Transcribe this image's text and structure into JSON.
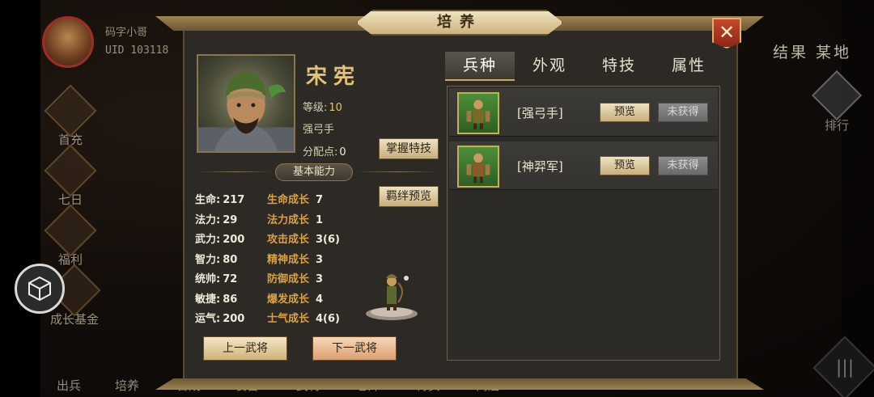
{
  "scene": {
    "player": {
      "name": "码字小哥",
      "uid": "UID  103118"
    },
    "right_title": "结果 某地",
    "rank_label": "排行",
    "side_buttons": [
      {
        "label": "首充"
      },
      {
        "label": "七日"
      },
      {
        "label": "福利"
      },
      {
        "label": "成长基金"
      }
    ],
    "bottom_buttons": [
      {
        "label": "出兵"
      },
      {
        "label": "培养"
      },
      {
        "label": "合成"
      },
      {
        "label": "装备"
      },
      {
        "label": "武将"
      },
      {
        "label": "仓库"
      },
      {
        "label": "待买"
      },
      {
        "label": "商店"
      }
    ],
    "menu_icon": "menu-icon"
  },
  "dialog": {
    "title": "培养",
    "close_icon": "close-x-icon",
    "hero": {
      "name": "宋宪",
      "level_label": "等级:",
      "level_value": "10",
      "troop_type": "强弓手",
      "points_label": "分配点:",
      "points_value": "0",
      "master_skill_button": "掌握特技",
      "bond_preview_button": "羁绊预览"
    },
    "section_title": "基本能力",
    "stats": [
      {
        "label": "生命:",
        "value": "217"
      },
      {
        "label": "法力:",
        "value": "29"
      },
      {
        "label": "武力:",
        "value": "200"
      },
      {
        "label": "智力:",
        "value": "80"
      },
      {
        "label": "统帅:",
        "value": "72"
      },
      {
        "label": "敏捷:",
        "value": "86"
      },
      {
        "label": "运气:",
        "value": "200"
      }
    ],
    "growth": [
      {
        "label": "生命成长",
        "value": "7"
      },
      {
        "label": "法力成长",
        "value": "1"
      },
      {
        "label": "攻击成长",
        "value": "3(6)"
      },
      {
        "label": "精神成长",
        "value": "3"
      },
      {
        "label": "防御成长",
        "value": "3"
      },
      {
        "label": "爆发成长",
        "value": "4"
      },
      {
        "label": "士气成长",
        "value": "4(6)"
      }
    ],
    "prev_button": "上一武将",
    "next_button": "下一武将",
    "tabs": [
      {
        "label": "兵种",
        "active": true
      },
      {
        "label": "外观",
        "active": false
      },
      {
        "label": "特技",
        "active": false
      },
      {
        "label": "属性",
        "active": false
      }
    ],
    "troops": [
      {
        "name": "[强弓手]",
        "preview": "预览",
        "status": "未获得"
      },
      {
        "name": "[神羿军]",
        "preview": "预览",
        "status": "未获得"
      }
    ]
  },
  "colors": {
    "gold_text": "#e3c17a",
    "growth_label": "#d9a04a",
    "panel_bg": "#2d2a26",
    "close_red": "#c24a2d"
  }
}
